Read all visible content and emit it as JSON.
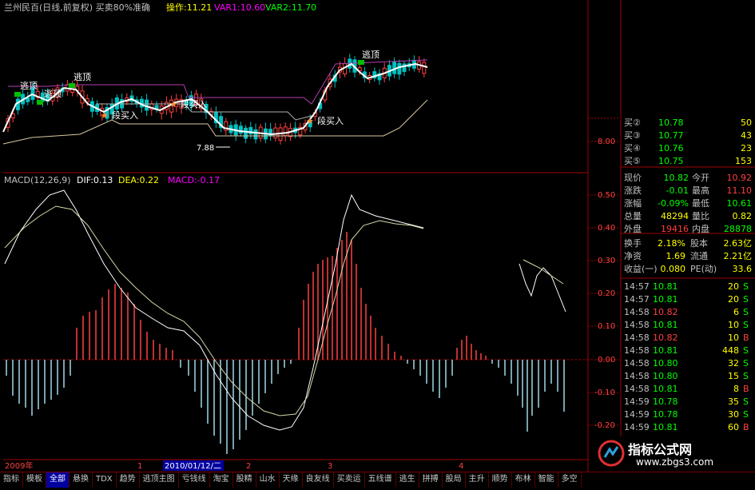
{
  "header": {
    "title": "兰州民百(日线,前复权) 买卖80%准确",
    "op_label": "操作:11.21",
    "var1": "VAR1:10.60",
    "var2": "VAR2:11.70"
  },
  "price_chart": {
    "annotations": [
      "逃顶",
      "逃顶",
      "逃顶",
      "逃顶",
      "段买入",
      "段买入",
      "段买入",
      "7.88"
    ],
    "ticks": [
      "8.00"
    ]
  },
  "macd": {
    "title": "MACD(12,26,9)",
    "dif": "DIF:0.13",
    "dea": "DEA:0.22",
    "macd": "MACD:-0.17",
    "ticks": [
      "0.50",
      "0.40",
      "0.30",
      "0.20",
      "0.10",
      "0.00",
      "-0.10",
      "-0.20"
    ]
  },
  "bottom_axis": {
    "year": "2009年",
    "marks": [
      "1",
      "2",
      "3",
      "4"
    ],
    "cursor_date": "2010/01/12/二"
  },
  "quote": {
    "bids": [
      {
        "label": "买②",
        "price": "10.78",
        "vol": "50"
      },
      {
        "label": "买③",
        "price": "10.77",
        "vol": "43"
      },
      {
        "label": "买④",
        "price": "10.76",
        "vol": "23"
      },
      {
        "label": "买⑤",
        "price": "10.75",
        "vol": "153"
      }
    ],
    "stats": [
      {
        "l1": "现价",
        "v1": "10.82",
        "l2": "今开",
        "v2": "10.92"
      },
      {
        "l1": "涨跌",
        "v1": "-0.01",
        "l2": "最高",
        "v2": "11.10"
      },
      {
        "l1": "涨幅",
        "v1": "-0.09%",
        "l2": "最低",
        "v2": "10.61"
      },
      {
        "l1": "总量",
        "v1": "48294",
        "l2": "量比",
        "v2": "0.82"
      },
      {
        "l1": "外盘",
        "v1": "19416",
        "l2": "内盘",
        "v2": "28878"
      }
    ],
    "stats2": [
      {
        "l1": "换手",
        "v1": "2.18%",
        "l2": "股本",
        "v2": "2.63亿"
      },
      {
        "l1": "净资",
        "v1": "1.69",
        "l2": "流通",
        "v2": "2.21亿"
      },
      {
        "l1": "收益(一)",
        "v1": "0.080",
        "l2": "PE(动)",
        "v2": "33.6"
      }
    ],
    "trades": [
      {
        "time": "14:57",
        "price": "10.81",
        "vol": "20",
        "side": "S"
      },
      {
        "time": "14:57",
        "price": "10.81",
        "vol": "20",
        "side": "S"
      },
      {
        "time": "14:58",
        "price": "10.82",
        "vol": "6",
        "side": "S"
      },
      {
        "time": "14:58",
        "price": "10.81",
        "vol": "10",
        "side": "S"
      },
      {
        "time": "14:58",
        "price": "10.82",
        "vol": "10",
        "side": "B"
      },
      {
        "time": "14:58",
        "price": "10.81",
        "vol": "448",
        "side": "S"
      },
      {
        "time": "14:58",
        "price": "10.80",
        "vol": "32",
        "side": "S"
      },
      {
        "time": "14:58",
        "price": "10.80",
        "vol": "15",
        "side": "S"
      },
      {
        "time": "14:58",
        "price": "10.81",
        "vol": "8",
        "side": "B"
      },
      {
        "time": "14:59",
        "price": "10.78",
        "vol": "35",
        "side": "S"
      },
      {
        "time": "14:59",
        "price": "10.78",
        "vol": "30",
        "side": "S"
      },
      {
        "time": "14:59",
        "price": "10.81",
        "vol": "60",
        "side": "B"
      },
      {
        "time": "14:59",
        "price": "10.81",
        "vol": "",
        "side": ""
      }
    ]
  },
  "toolbar": {
    "tabs": [
      "指标",
      "模板",
      "全部",
      "悬换",
      "TDX",
      "趋势",
      "逃顶主图",
      "亏钱线",
      "淘宝",
      "股精",
      "山水",
      "天缘",
      "良友线",
      "买卖运",
      "五线谱",
      "逃生",
      "拼搏",
      "股局",
      "主升",
      "顺势",
      "布林",
      "智能",
      "多空"
    ]
  },
  "watermark": {
    "title": "指标公式网",
    "url": "www.zbgs3.com"
  },
  "colors": {
    "axis": "#a00000",
    "up": "#ff4040",
    "down": "#00c0c0",
    "white": "#ffffff",
    "yellow": "#ffff00",
    "purple": "#ff00ff",
    "green": "#00c000"
  }
}
